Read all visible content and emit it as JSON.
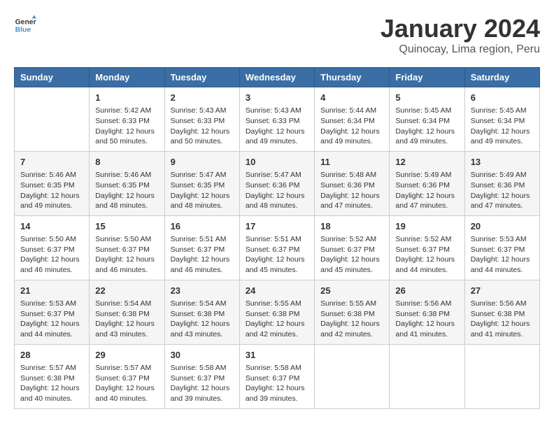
{
  "header": {
    "logo_line1": "General",
    "logo_line2": "Blue",
    "title": "January 2024",
    "subtitle": "Quinocay, Lima region, Peru"
  },
  "weekdays": [
    "Sunday",
    "Monday",
    "Tuesday",
    "Wednesday",
    "Thursday",
    "Friday",
    "Saturday"
  ],
  "weeks": [
    [
      {
        "day": "",
        "info": ""
      },
      {
        "day": "1",
        "info": "Sunrise: 5:42 AM\nSunset: 6:33 PM\nDaylight: 12 hours\nand 50 minutes."
      },
      {
        "day": "2",
        "info": "Sunrise: 5:43 AM\nSunset: 6:33 PM\nDaylight: 12 hours\nand 50 minutes."
      },
      {
        "day": "3",
        "info": "Sunrise: 5:43 AM\nSunset: 6:33 PM\nDaylight: 12 hours\nand 49 minutes."
      },
      {
        "day": "4",
        "info": "Sunrise: 5:44 AM\nSunset: 6:34 PM\nDaylight: 12 hours\nand 49 minutes."
      },
      {
        "day": "5",
        "info": "Sunrise: 5:45 AM\nSunset: 6:34 PM\nDaylight: 12 hours\nand 49 minutes."
      },
      {
        "day": "6",
        "info": "Sunrise: 5:45 AM\nSunset: 6:34 PM\nDaylight: 12 hours\nand 49 minutes."
      }
    ],
    [
      {
        "day": "7",
        "info": "Sunrise: 5:46 AM\nSunset: 6:35 PM\nDaylight: 12 hours\nand 49 minutes."
      },
      {
        "day": "8",
        "info": "Sunrise: 5:46 AM\nSunset: 6:35 PM\nDaylight: 12 hours\nand 48 minutes."
      },
      {
        "day": "9",
        "info": "Sunrise: 5:47 AM\nSunset: 6:35 PM\nDaylight: 12 hours\nand 48 minutes."
      },
      {
        "day": "10",
        "info": "Sunrise: 5:47 AM\nSunset: 6:36 PM\nDaylight: 12 hours\nand 48 minutes."
      },
      {
        "day": "11",
        "info": "Sunrise: 5:48 AM\nSunset: 6:36 PM\nDaylight: 12 hours\nand 47 minutes."
      },
      {
        "day": "12",
        "info": "Sunrise: 5:49 AM\nSunset: 6:36 PM\nDaylight: 12 hours\nand 47 minutes."
      },
      {
        "day": "13",
        "info": "Sunrise: 5:49 AM\nSunset: 6:36 PM\nDaylight: 12 hours\nand 47 minutes."
      }
    ],
    [
      {
        "day": "14",
        "info": "Sunrise: 5:50 AM\nSunset: 6:37 PM\nDaylight: 12 hours\nand 46 minutes."
      },
      {
        "day": "15",
        "info": "Sunrise: 5:50 AM\nSunset: 6:37 PM\nDaylight: 12 hours\nand 46 minutes."
      },
      {
        "day": "16",
        "info": "Sunrise: 5:51 AM\nSunset: 6:37 PM\nDaylight: 12 hours\nand 46 minutes."
      },
      {
        "day": "17",
        "info": "Sunrise: 5:51 AM\nSunset: 6:37 PM\nDaylight: 12 hours\nand 45 minutes."
      },
      {
        "day": "18",
        "info": "Sunrise: 5:52 AM\nSunset: 6:37 PM\nDaylight: 12 hours\nand 45 minutes."
      },
      {
        "day": "19",
        "info": "Sunrise: 5:52 AM\nSunset: 6:37 PM\nDaylight: 12 hours\nand 44 minutes."
      },
      {
        "day": "20",
        "info": "Sunrise: 5:53 AM\nSunset: 6:37 PM\nDaylight: 12 hours\nand 44 minutes."
      }
    ],
    [
      {
        "day": "21",
        "info": "Sunrise: 5:53 AM\nSunset: 6:37 PM\nDaylight: 12 hours\nand 44 minutes."
      },
      {
        "day": "22",
        "info": "Sunrise: 5:54 AM\nSunset: 6:38 PM\nDaylight: 12 hours\nand 43 minutes."
      },
      {
        "day": "23",
        "info": "Sunrise: 5:54 AM\nSunset: 6:38 PM\nDaylight: 12 hours\nand 43 minutes."
      },
      {
        "day": "24",
        "info": "Sunrise: 5:55 AM\nSunset: 6:38 PM\nDaylight: 12 hours\nand 42 minutes."
      },
      {
        "day": "25",
        "info": "Sunrise: 5:55 AM\nSunset: 6:38 PM\nDaylight: 12 hours\nand 42 minutes."
      },
      {
        "day": "26",
        "info": "Sunrise: 5:56 AM\nSunset: 6:38 PM\nDaylight: 12 hours\nand 41 minutes."
      },
      {
        "day": "27",
        "info": "Sunrise: 5:56 AM\nSunset: 6:38 PM\nDaylight: 12 hours\nand 41 minutes."
      }
    ],
    [
      {
        "day": "28",
        "info": "Sunrise: 5:57 AM\nSunset: 6:38 PM\nDaylight: 12 hours\nand 40 minutes."
      },
      {
        "day": "29",
        "info": "Sunrise: 5:57 AM\nSunset: 6:37 PM\nDaylight: 12 hours\nand 40 minutes."
      },
      {
        "day": "30",
        "info": "Sunrise: 5:58 AM\nSunset: 6:37 PM\nDaylight: 12 hours\nand 39 minutes."
      },
      {
        "day": "31",
        "info": "Sunrise: 5:58 AM\nSunset: 6:37 PM\nDaylight: 12 hours\nand 39 minutes."
      },
      {
        "day": "",
        "info": ""
      },
      {
        "day": "",
        "info": ""
      },
      {
        "day": "",
        "info": ""
      }
    ]
  ]
}
